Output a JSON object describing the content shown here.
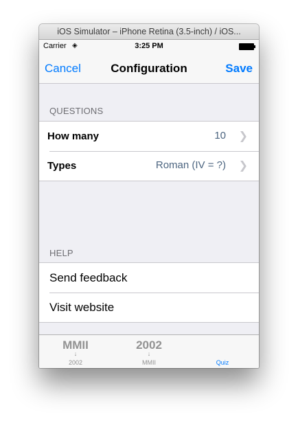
{
  "window": {
    "title": "iOS Simulator – iPhone Retina (3.5-inch) / iOS..."
  },
  "statusbar": {
    "carrier": "Carrier",
    "time": "3:25 PM"
  },
  "navbar": {
    "cancel": "Cancel",
    "title": "Configuration",
    "save": "Save"
  },
  "questions": {
    "header": "QUESTIONS",
    "rows": [
      {
        "label": "How many",
        "value": "10"
      },
      {
        "label": "Types",
        "value": "Roman (IV = ?)"
      }
    ]
  },
  "help": {
    "header": "HELP",
    "rows": [
      {
        "label": "Send feedback"
      },
      {
        "label": "Visit website"
      }
    ]
  },
  "tabbar": {
    "tabs": [
      {
        "icon_text": "MMII",
        "label": "2002",
        "active": false
      },
      {
        "icon_text": "2002",
        "label": "MMII",
        "active": false
      },
      {
        "icon_text": "",
        "label": "Quiz",
        "active": true
      }
    ]
  },
  "colors": {
    "accent": "#007aff",
    "value": "#4c6580",
    "background": "#efeff4"
  }
}
